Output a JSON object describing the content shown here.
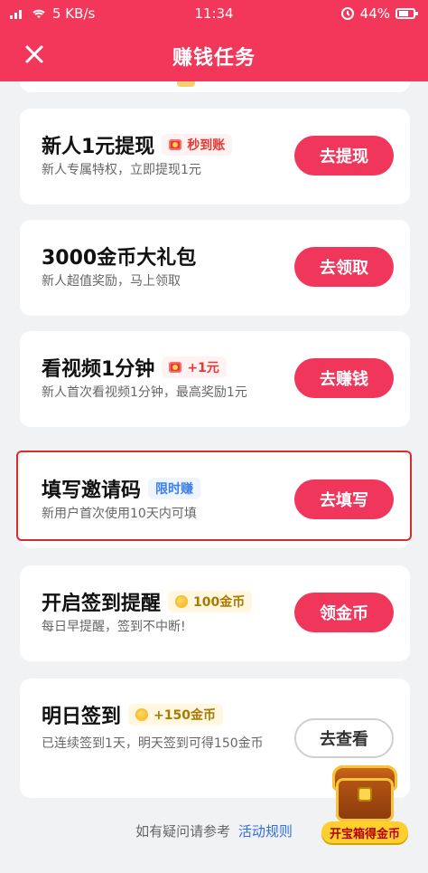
{
  "status": {
    "left_text": "5 KB/s",
    "time": "11:34",
    "battery": "44%"
  },
  "header": {
    "title": "赚钱任务"
  },
  "tasks": [
    {
      "title": "新人1元提现",
      "badge": "秒到账",
      "subtitle": "新人专属特权，立即提现1元",
      "button": "去提现"
    },
    {
      "title": "3000金币大礼包",
      "badge": "",
      "subtitle": "新人超值奖励，马上领取",
      "button": "去领取"
    },
    {
      "title": "看视频1分钟",
      "badge": "+1元",
      "subtitle": "新人首次看视频1分钟，最高奖励1元",
      "button": "去赚钱"
    },
    {
      "title": "填写邀请码",
      "badge": "限时赚",
      "subtitle": "新用户首次使用10天内可填",
      "button": "去填写"
    },
    {
      "title": "开启签到提醒",
      "badge": "100金币",
      "subtitle": "每日早提醒，签到不中断!",
      "button": "领金币"
    },
    {
      "title": "明日签到",
      "badge": "+150金币",
      "subtitle": "已连续签到1天，明天签到可得150金币",
      "button": "去查看"
    }
  ],
  "footer": {
    "prefix": "如有疑问请参考",
    "link": "活动规则"
  },
  "treasure": {
    "label": "开宝箱得金币"
  },
  "colors": {
    "primary": "#f2375a",
    "button": "#f0365b",
    "highlight": "#d32f2f"
  },
  "icons": {
    "close": "close-icon",
    "signal": "signal-icon",
    "wifi": "wifi-icon",
    "battery": "battery-icon",
    "alarm": "alarm-icon",
    "envelope": "red-envelope-icon",
    "coin": "coin-icon",
    "chest": "treasure-chest-icon"
  }
}
